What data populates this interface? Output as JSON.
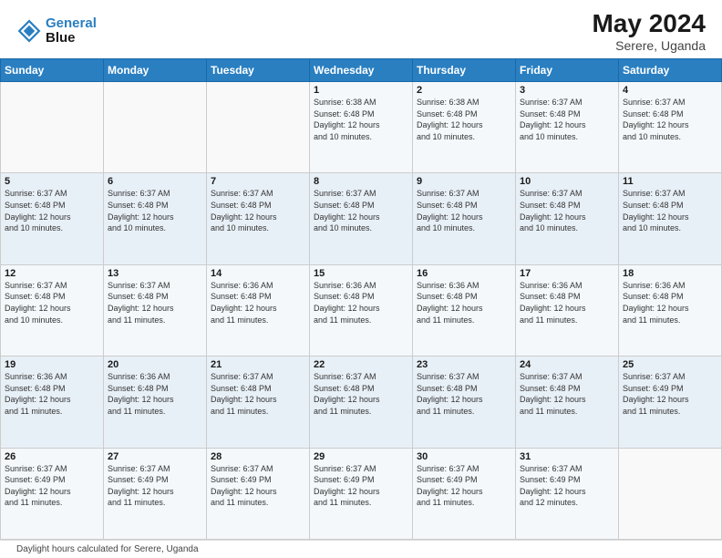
{
  "header": {
    "logo_line1": "General",
    "logo_line2": "Blue",
    "month_year": "May 2024",
    "location": "Serere, Uganda"
  },
  "days_of_week": [
    "Sunday",
    "Monday",
    "Tuesday",
    "Wednesday",
    "Thursday",
    "Friday",
    "Saturday"
  ],
  "weeks": [
    [
      {
        "day": "",
        "info": ""
      },
      {
        "day": "",
        "info": ""
      },
      {
        "day": "",
        "info": ""
      },
      {
        "day": "1",
        "info": "Sunrise: 6:38 AM\nSunset: 6:48 PM\nDaylight: 12 hours\nand 10 minutes."
      },
      {
        "day": "2",
        "info": "Sunrise: 6:38 AM\nSunset: 6:48 PM\nDaylight: 12 hours\nand 10 minutes."
      },
      {
        "day": "3",
        "info": "Sunrise: 6:37 AM\nSunset: 6:48 PM\nDaylight: 12 hours\nand 10 minutes."
      },
      {
        "day": "4",
        "info": "Sunrise: 6:37 AM\nSunset: 6:48 PM\nDaylight: 12 hours\nand 10 minutes."
      }
    ],
    [
      {
        "day": "5",
        "info": "Sunrise: 6:37 AM\nSunset: 6:48 PM\nDaylight: 12 hours\nand 10 minutes."
      },
      {
        "day": "6",
        "info": "Sunrise: 6:37 AM\nSunset: 6:48 PM\nDaylight: 12 hours\nand 10 minutes."
      },
      {
        "day": "7",
        "info": "Sunrise: 6:37 AM\nSunset: 6:48 PM\nDaylight: 12 hours\nand 10 minutes."
      },
      {
        "day": "8",
        "info": "Sunrise: 6:37 AM\nSunset: 6:48 PM\nDaylight: 12 hours\nand 10 minutes."
      },
      {
        "day": "9",
        "info": "Sunrise: 6:37 AM\nSunset: 6:48 PM\nDaylight: 12 hours\nand 10 minutes."
      },
      {
        "day": "10",
        "info": "Sunrise: 6:37 AM\nSunset: 6:48 PM\nDaylight: 12 hours\nand 10 minutes."
      },
      {
        "day": "11",
        "info": "Sunrise: 6:37 AM\nSunset: 6:48 PM\nDaylight: 12 hours\nand 10 minutes."
      }
    ],
    [
      {
        "day": "12",
        "info": "Sunrise: 6:37 AM\nSunset: 6:48 PM\nDaylight: 12 hours\nand 10 minutes."
      },
      {
        "day": "13",
        "info": "Sunrise: 6:37 AM\nSunset: 6:48 PM\nDaylight: 12 hours\nand 11 minutes."
      },
      {
        "day": "14",
        "info": "Sunrise: 6:36 AM\nSunset: 6:48 PM\nDaylight: 12 hours\nand 11 minutes."
      },
      {
        "day": "15",
        "info": "Sunrise: 6:36 AM\nSunset: 6:48 PM\nDaylight: 12 hours\nand 11 minutes."
      },
      {
        "day": "16",
        "info": "Sunrise: 6:36 AM\nSunset: 6:48 PM\nDaylight: 12 hours\nand 11 minutes."
      },
      {
        "day": "17",
        "info": "Sunrise: 6:36 AM\nSunset: 6:48 PM\nDaylight: 12 hours\nand 11 minutes."
      },
      {
        "day": "18",
        "info": "Sunrise: 6:36 AM\nSunset: 6:48 PM\nDaylight: 12 hours\nand 11 minutes."
      }
    ],
    [
      {
        "day": "19",
        "info": "Sunrise: 6:36 AM\nSunset: 6:48 PM\nDaylight: 12 hours\nand 11 minutes."
      },
      {
        "day": "20",
        "info": "Sunrise: 6:36 AM\nSunset: 6:48 PM\nDaylight: 12 hours\nand 11 minutes."
      },
      {
        "day": "21",
        "info": "Sunrise: 6:37 AM\nSunset: 6:48 PM\nDaylight: 12 hours\nand 11 minutes."
      },
      {
        "day": "22",
        "info": "Sunrise: 6:37 AM\nSunset: 6:48 PM\nDaylight: 12 hours\nand 11 minutes."
      },
      {
        "day": "23",
        "info": "Sunrise: 6:37 AM\nSunset: 6:48 PM\nDaylight: 12 hours\nand 11 minutes."
      },
      {
        "day": "24",
        "info": "Sunrise: 6:37 AM\nSunset: 6:48 PM\nDaylight: 12 hours\nand 11 minutes."
      },
      {
        "day": "25",
        "info": "Sunrise: 6:37 AM\nSunset: 6:49 PM\nDaylight: 12 hours\nand 11 minutes."
      }
    ],
    [
      {
        "day": "26",
        "info": "Sunrise: 6:37 AM\nSunset: 6:49 PM\nDaylight: 12 hours\nand 11 minutes."
      },
      {
        "day": "27",
        "info": "Sunrise: 6:37 AM\nSunset: 6:49 PM\nDaylight: 12 hours\nand 11 minutes."
      },
      {
        "day": "28",
        "info": "Sunrise: 6:37 AM\nSunset: 6:49 PM\nDaylight: 12 hours\nand 11 minutes."
      },
      {
        "day": "29",
        "info": "Sunrise: 6:37 AM\nSunset: 6:49 PM\nDaylight: 12 hours\nand 11 minutes."
      },
      {
        "day": "30",
        "info": "Sunrise: 6:37 AM\nSunset: 6:49 PM\nDaylight: 12 hours\nand 11 minutes."
      },
      {
        "day": "31",
        "info": "Sunrise: 6:37 AM\nSunset: 6:49 PM\nDaylight: 12 hours\nand 12 minutes."
      },
      {
        "day": "",
        "info": ""
      }
    ]
  ],
  "footer": {
    "note": "Daylight hours calculated for Serere, Uganda"
  }
}
